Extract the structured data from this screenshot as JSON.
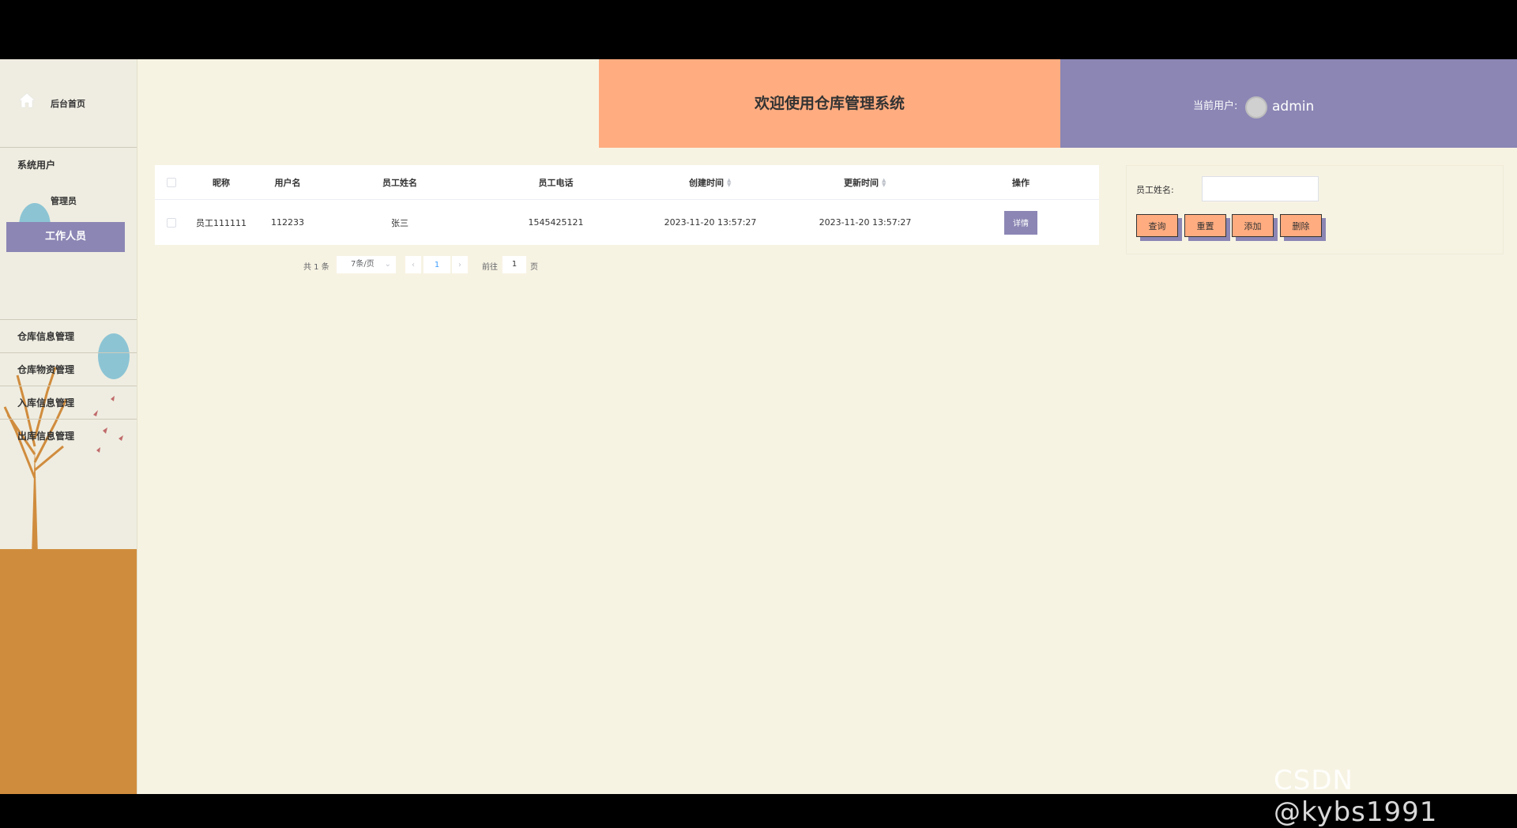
{
  "sidebar": {
    "home_label": "后台首页",
    "group_label": "系统用户",
    "sub_items": [
      "管理员",
      "工作人员"
    ],
    "menu_items": [
      "仓库信息管理",
      "仓库物资管理",
      "入库信息管理",
      "出库信息管理"
    ]
  },
  "header": {
    "title": "欢迎使用仓库管理系统",
    "current_user_label": "当前用户:",
    "username": "admin"
  },
  "table": {
    "columns": [
      "昵称",
      "用户名",
      "员工姓名",
      "员工电话",
      "创建时间",
      "更新时间",
      "操作"
    ],
    "rows": [
      {
        "nickname": "员工111111",
        "username": "112233",
        "name": "张三",
        "phone": "1545425121",
        "created": "2023-11-20 13:57:27",
        "updated": "2023-11-20 13:57:27",
        "action_label": "详情"
      }
    ]
  },
  "pagination": {
    "total_text": "共 1 条",
    "page_size": "7条/页",
    "current_page": "1",
    "goto_label": "前往",
    "goto_value": "1",
    "page_suffix": "页"
  },
  "search": {
    "label": "员工姓名:",
    "value": "",
    "buttons": [
      "查询",
      "重置",
      "添加",
      "删除"
    ]
  },
  "watermark": "CSDN @kybs1991",
  "colors": {
    "accent_orange": "#ffac80",
    "accent_purple": "#8b86b4",
    "background": "#f7f3e3"
  }
}
